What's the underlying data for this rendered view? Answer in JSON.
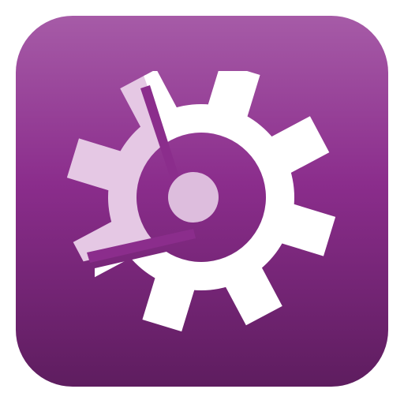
{
  "icon": {
    "name": "gear-icon",
    "colors": {
      "background_top": "#a65ba7",
      "background_mid": "#8b2d8c",
      "background_bottom": "#5e1d5f",
      "gear_light": "#ffffff",
      "gear_shaded": "#e5c8e4",
      "hub": "#ddbddd"
    }
  }
}
